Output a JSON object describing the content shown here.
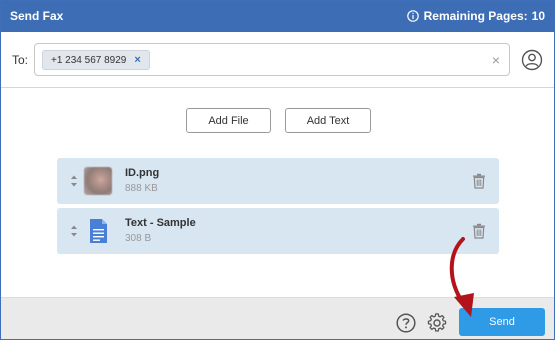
{
  "titlebar": {
    "title": "Send Fax",
    "remaining_label": "Remaining Pages:",
    "remaining_value": "10"
  },
  "to": {
    "label": "To:",
    "chips": [
      {
        "number": "+1 234 567 8929",
        "remove": "×"
      }
    ],
    "clear": "×"
  },
  "actions": {
    "add_file": "Add File",
    "add_text": "Add Text"
  },
  "files": [
    {
      "name": "ID.png",
      "size": "888 KB",
      "icon": "image-thumbnail"
    },
    {
      "name": "Text - Sample",
      "size": "308 B",
      "icon": "document-icon"
    }
  ],
  "footer": {
    "send_label": "Send"
  },
  "colors": {
    "titlebar": "#3d6db5",
    "file_row": "#d8e6f2",
    "send": "#2f9ae5",
    "annotation_arrow": "#b3141b"
  }
}
